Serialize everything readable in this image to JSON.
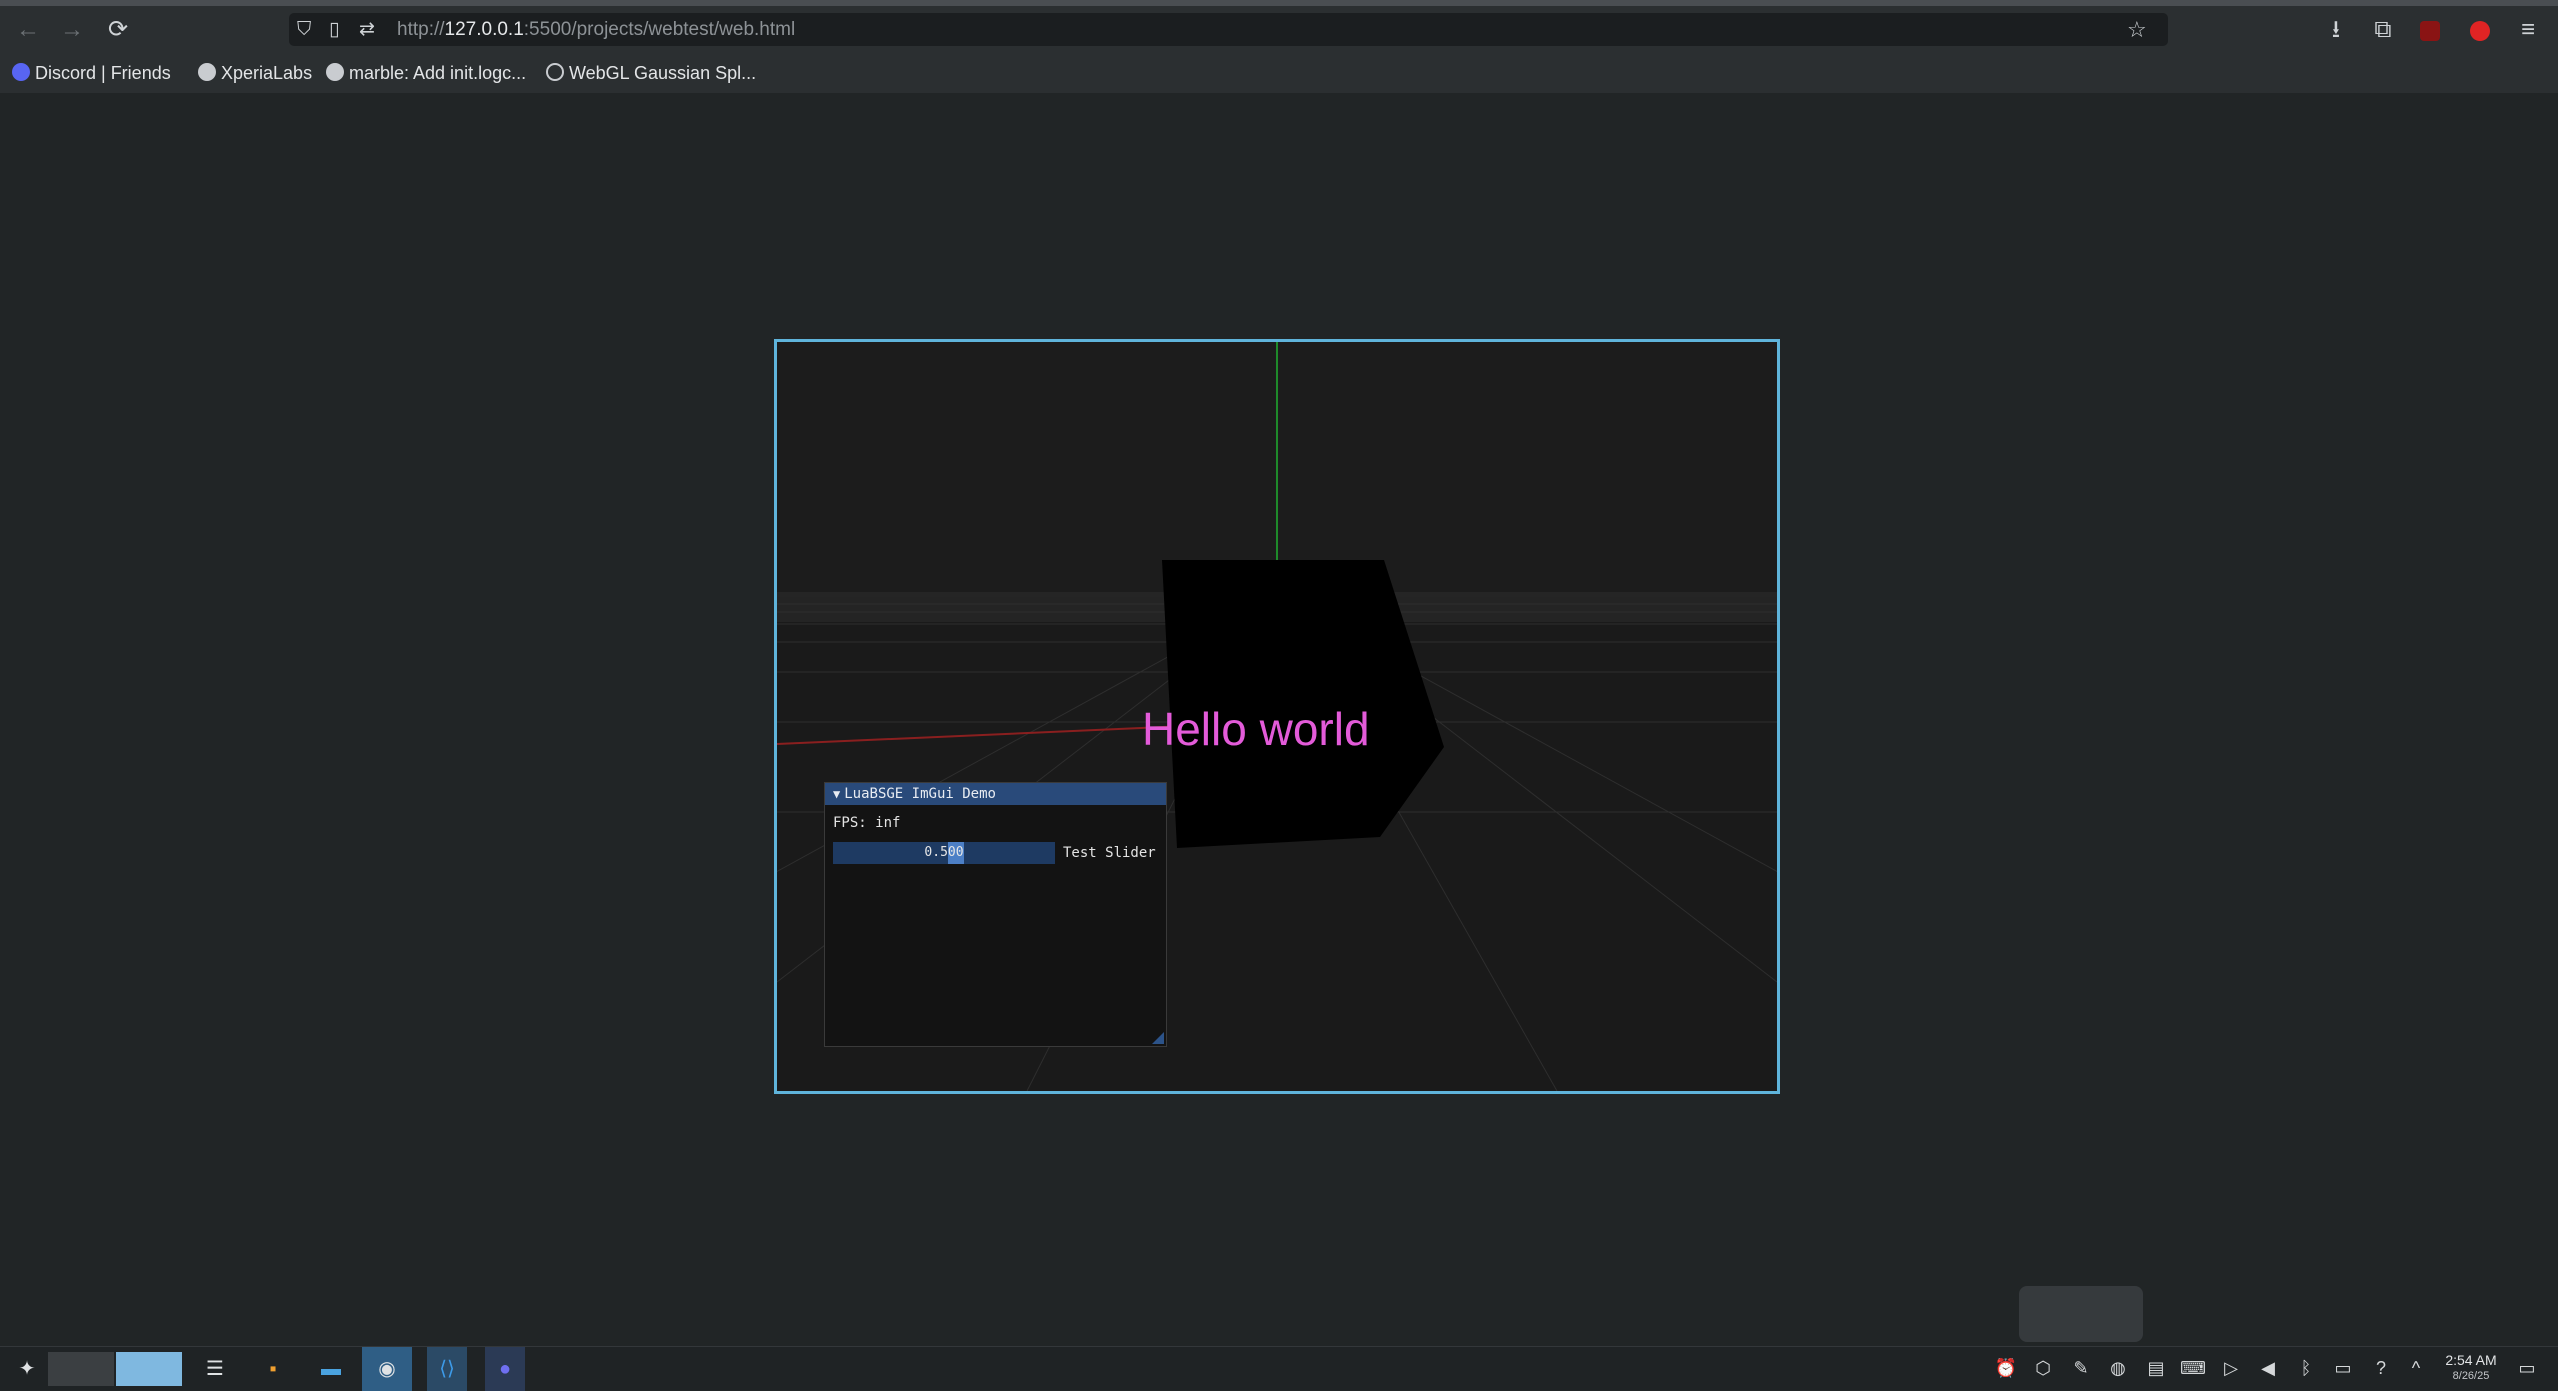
{
  "browser": {
    "url_prefix": "http://",
    "url_host": "127.0.0.1",
    "url_rest": ":5500/projects/webtest/web.html",
    "back_icon": "←",
    "forward_icon": "→",
    "reload_icon": "⟳",
    "star_icon": "☆",
    "downloads_icon": "⭳",
    "extensions_icon": "⧉",
    "menu_icon": "≡"
  },
  "bookmarks": [
    {
      "label": "Discord | Friends",
      "color": "#5865f2"
    },
    {
      "label": "XperiaLabs",
      "color": "#c9ccd0"
    },
    {
      "label": "marble: Add init.logc...",
      "color": "#c9ccd0"
    },
    {
      "label": "WebGL Gaussian Spl...",
      "color": "#c9ccd0"
    }
  ],
  "scene": {
    "text": "Hello world",
    "text_color": "#e35bd9"
  },
  "imgui": {
    "title": "LuaBSGE ImGui Demo",
    "collapse_icon": "▼",
    "fps_label": "FPS: inf",
    "slider_value_a": "0.5",
    "slider_value_b": "00",
    "slider_label": "Test Slider"
  },
  "taskbar": {
    "time": "2:54 AM",
    "date": "8/26/25"
  }
}
